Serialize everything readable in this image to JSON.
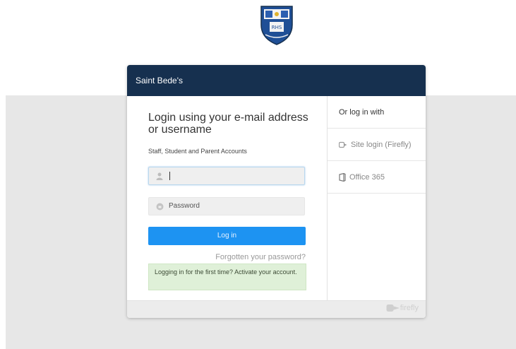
{
  "header": {
    "school_name": "Saint Bede's"
  },
  "crest": {
    "text": "RHS"
  },
  "login": {
    "title": "Login using your e-mail address or username",
    "accounts_label": "Staff, Student and Parent Accounts",
    "username_value": "",
    "password_placeholder": "Password",
    "login_button": "Log in",
    "forgot_link": "Forgotten your password?",
    "activate_notice": "Logging in for the first time? Activate your account."
  },
  "alt_login": {
    "heading": "Or log in with",
    "items": [
      {
        "label": "Site login (Firefly)",
        "icon": "firefly-icon"
      },
      {
        "label": "Office 365",
        "icon": "office-icon"
      }
    ]
  },
  "footer": {
    "brand": "firefly"
  },
  "colors": {
    "header_bg": "#16304f",
    "button_bg": "#1d93f2",
    "notice_bg": "#dff0d8",
    "page_band": "#e7e7e7"
  }
}
